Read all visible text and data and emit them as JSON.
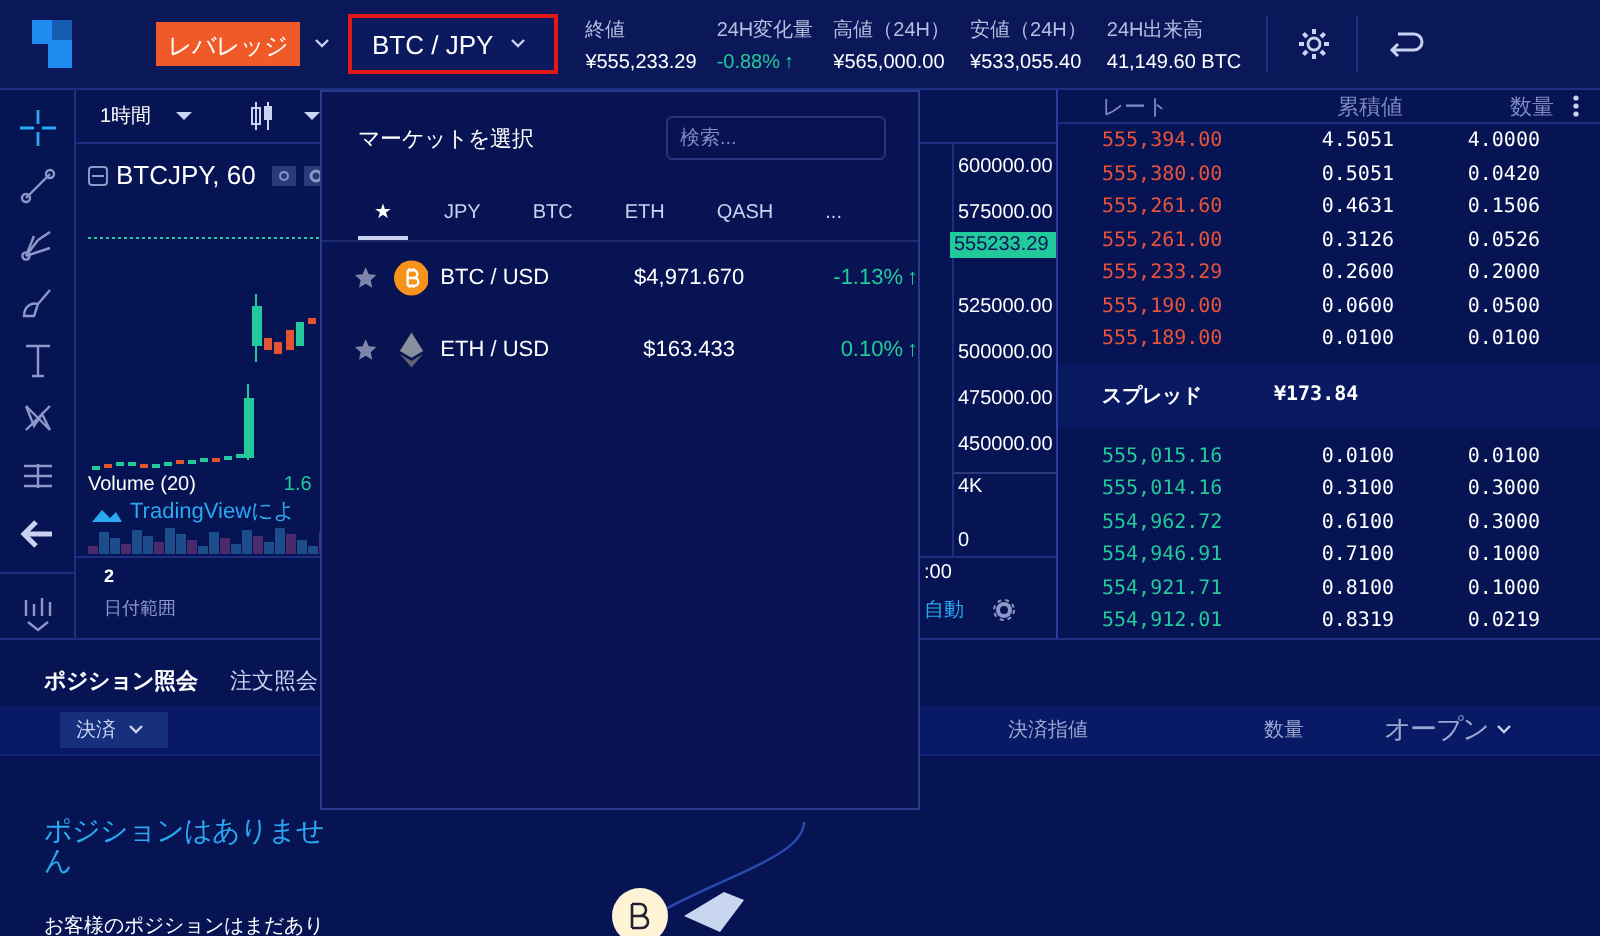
{
  "header": {
    "leverage_button": "レバレッジ",
    "pair_button": {
      "label": "BTC / JPY",
      "highlighted": true
    },
    "stats": [
      {
        "kind": "plain",
        "label": "終値",
        "value": "¥555,233.29"
      },
      {
        "kind": "change",
        "label": "24H変化量",
        "value": "-0.88%",
        "arrow": "↑"
      },
      {
        "kind": "plain",
        "label": "高値（24H）",
        "value": "¥565,000.00"
      },
      {
        "kind": "plain",
        "label": "安値（24H）",
        "value": "¥533,055.40"
      },
      {
        "kind": "plain",
        "label": "24H出来高",
        "value": "41,149.60 BTC"
      }
    ]
  },
  "chart": {
    "interval": "1時間",
    "symbol": "BTCJPY, 60",
    "price_axis": [
      "600000.00",
      "575000.00",
      "525000.00",
      "500000.00",
      "475000.00",
      "450000.00"
    ],
    "last_price": "555233.29",
    "volume_axis": [
      "4K",
      "0"
    ],
    "volume_label": "Volume (20)",
    "volume_value": "1.6",
    "branding": "TradingViewによ",
    "date_range_value": "2",
    "date_range_label": "日付範囲",
    "time_label": ":00",
    "auto_button": "自動"
  },
  "market_popup": {
    "title": "マーケットを選択",
    "search": {
      "placeholder": "検索..."
    },
    "tabs": [
      {
        "label": "★",
        "selected": true
      },
      {
        "label": "JPY",
        "selected": false
      },
      {
        "label": "BTC",
        "selected": false
      },
      {
        "label": "ETH",
        "selected": false
      },
      {
        "label": "QASH",
        "selected": false
      },
      {
        "label": "...",
        "selected": false
      }
    ],
    "rows": [
      {
        "kind": "btc",
        "pair": "BTC / USD",
        "price": "$4,971.670",
        "change": "-1.13%",
        "arrow": "↑"
      },
      {
        "kind": "eth",
        "pair": "ETH / USD",
        "price": "$163.433",
        "change": "0.10%",
        "arrow": "↑"
      }
    ]
  },
  "order_book": {
    "columns": [
      "レート",
      "累積値",
      "数量"
    ],
    "asks": [
      {
        "rate": "555,394.00",
        "total": "4.5051",
        "amount": "4.0000"
      },
      {
        "rate": "555,380.00",
        "total": "0.5051",
        "amount": "0.0420"
      },
      {
        "rate": "555,261.60",
        "total": "0.4631",
        "amount": "0.1506"
      },
      {
        "rate": "555,261.00",
        "total": "0.3126",
        "amount": "0.0526"
      },
      {
        "rate": "555,233.29",
        "total": "0.2600",
        "amount": "0.2000"
      },
      {
        "rate": "555,190.00",
        "total": "0.0600",
        "amount": "0.0500"
      },
      {
        "rate": "555,189.00",
        "total": "0.0100",
        "amount": "0.0100"
      }
    ],
    "spread": {
      "label": "スプレッド",
      "value": "¥173.84"
    },
    "bids": [
      {
        "rate": "555,015.16",
        "total": "0.0100",
        "amount": "0.0100"
      },
      {
        "rate": "555,014.16",
        "total": "0.3100",
        "amount": "0.3000"
      },
      {
        "rate": "554,962.72",
        "total": "0.6100",
        "amount": "0.3000"
      },
      {
        "rate": "554,946.91",
        "total": "0.7100",
        "amount": "0.1000"
      },
      {
        "rate": "554,921.71",
        "total": "0.8100",
        "amount": "0.1000"
      },
      {
        "rate": "554,912.01",
        "total": "0.8319",
        "amount": "0.0219"
      }
    ]
  },
  "positions": {
    "tabs": [
      {
        "label": "ポジション照会",
        "selected": true
      },
      {
        "label": "注文照会",
        "selected": false
      }
    ],
    "filter_button": "決済",
    "columns": [
      {
        "label": "決済指値",
        "dropdown": false
      },
      {
        "label": "数量",
        "dropdown": false
      },
      {
        "label": "オープン",
        "dropdown": true
      }
    ],
    "empty_title": "ポジションはありません",
    "empty_text": "お客様のポジションはまだあり"
  }
}
